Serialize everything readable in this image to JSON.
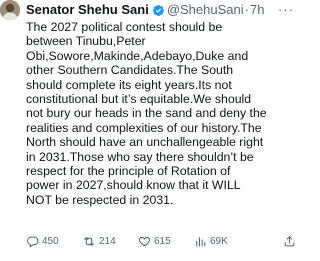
{
  "tweet": {
    "author_name": "Senator Shehu Sani",
    "handle": "@ShehuSani",
    "separator": "·",
    "time": "7h",
    "verified": true,
    "text": "The 2027 political contest should be\nbetween Tinubu,Peter\nObi,Sowore,Makinde,Adebayo,Duke and\nother Southern Candidates.The South\nshould complete its eight years.Its not\nconstitutional but it’s equitable.We should\nnot bury our heads in the sand and deny the\nrealities and complexities of our history.The\nNorth should have an unchallengeable right\nin 2031.Those who say there shouldn’t be\nrespect for the principle of Rotation of\npower in 2027,should know that it WILL\nNOT be respected in 2031."
  },
  "actions": {
    "replies": "450",
    "reposts": "214",
    "likes": "615",
    "views": "69K"
  },
  "icons": {
    "avatar": "profile-photo",
    "verified": "verified-badge-icon",
    "more": "more-options-icon",
    "reply": "reply-icon",
    "repost": "repost-icon",
    "like": "heart-icon",
    "views": "views-chart-icon",
    "share": "share-icon"
  },
  "colors": {
    "text": "#0f1419",
    "secondary": "#536471",
    "verified_blue": "#1d9bf0"
  }
}
